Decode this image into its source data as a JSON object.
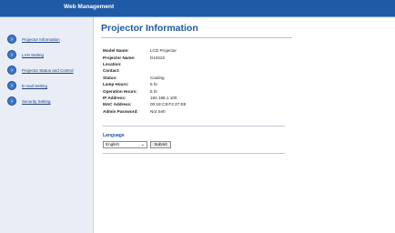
{
  "header": {
    "title": "Web Management"
  },
  "sidebar": {
    "items": [
      {
        "label": "Projector Information"
      },
      {
        "label": "LAN Setting"
      },
      {
        "label": "Projector Status and Control"
      },
      {
        "label": "E-mail Setting"
      },
      {
        "label": "Security Setting"
      }
    ]
  },
  "main": {
    "title": "Projector Information",
    "info": [
      {
        "key": "Model Name:",
        "value": "LCD Projector"
      },
      {
        "key": "Projector Name:",
        "value": "D10222"
      },
      {
        "key": "Location:",
        "value": ""
      },
      {
        "key": "Contact:",
        "value": ""
      },
      {
        "key": "Status:",
        "value": "Cooling"
      },
      {
        "key": "Lamp Hours:",
        "value": "5 hr."
      },
      {
        "key": "Operation Hours:",
        "value": "5 hr."
      },
      {
        "key": "IP Address:",
        "value": "192.168.1.100"
      },
      {
        "key": "MAC Address:",
        "value": "00:1E:C8:F2:27:EE"
      },
      {
        "key": "Admin Password:",
        "value": "Not Set!"
      }
    ],
    "language": {
      "label": "Language",
      "selected": "English",
      "submit_label": "Submit"
    }
  },
  "colors": {
    "brand": "#1f5aa6",
    "sidebar_bg": "#e9eef6",
    "link": "#1d3f84"
  },
  "icons": {
    "nav": "arrow-circle-icon",
    "select": "chevron-down-icon"
  }
}
